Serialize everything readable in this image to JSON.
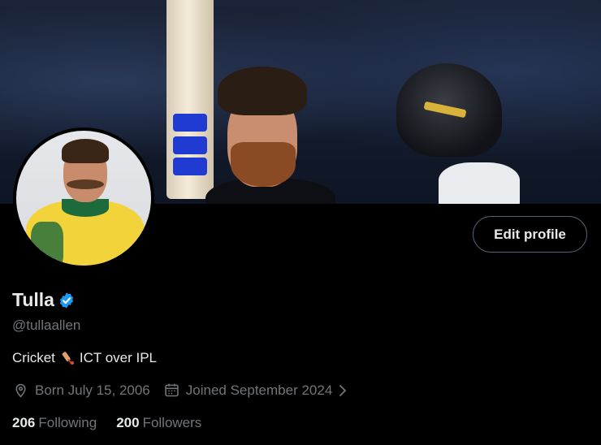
{
  "profile": {
    "name": "Tulla",
    "handle": "@tullaallen",
    "bio_before": "Cricket",
    "bio_after": "ICT over IPL",
    "born": "Born July 15, 2006",
    "joined": "Joined September 2024",
    "following_count": "206",
    "following_label": "Following",
    "followers_count": "200",
    "followers_label": "Followers"
  },
  "actions": {
    "edit_label": "Edit profile"
  },
  "icons": {
    "verified": "verified-badge-icon",
    "bio_emoji": "cricket-bat-icon",
    "location": "location-pin-icon",
    "calendar": "calendar-icon",
    "chevron": "chevron-right-icon"
  },
  "colors": {
    "background": "#000000",
    "primary_text": "#e7e9ea",
    "secondary_text": "#71767b",
    "verified_blue": "#1d9bf0",
    "button_border": "#536471"
  }
}
